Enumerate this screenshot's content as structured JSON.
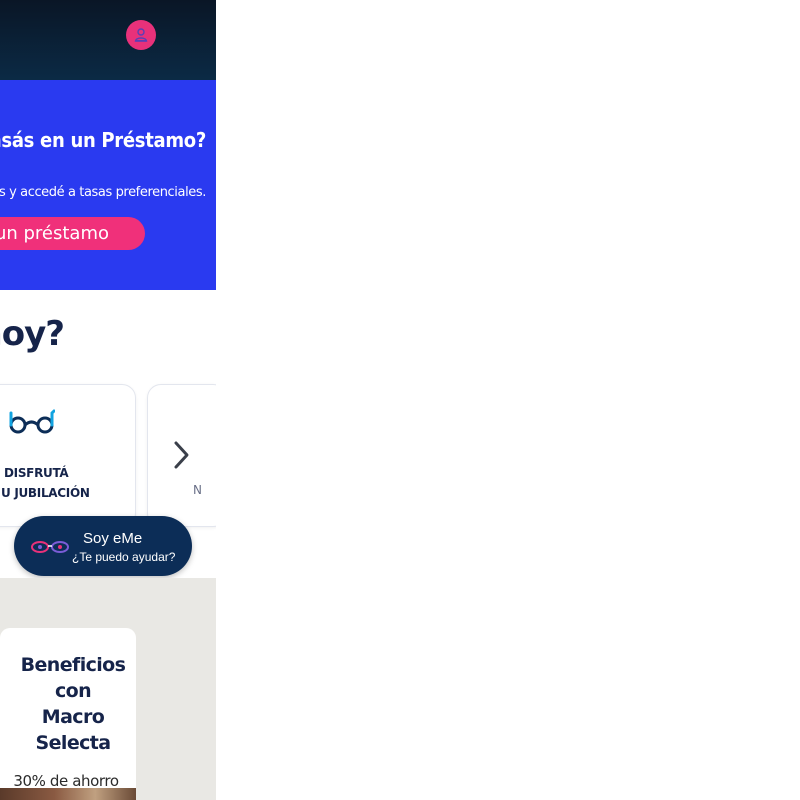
{
  "header": {
    "profile_icon": "person-icon"
  },
  "hero": {
    "title": "ensás en un Préstamo?",
    "subtitle": "ros y accedé a tasas preferenciales.",
    "cta_label": "un préstamo"
  },
  "section": {
    "heading": "hoy?"
  },
  "cards": [
    {
      "icon": "glasses-icon",
      "line1": "DISFRUTÁ",
      "line2": "U JUBILACIÓN"
    },
    {
      "label": "N"
    }
  ],
  "carousel": {
    "next_icon": "chevron-right-icon"
  },
  "chat": {
    "title": "Soy eMe",
    "subtitle": "¿Te puedo ayudar?",
    "icon": "eyes-icon"
  },
  "benefit": {
    "title_lines": [
      "Beneficios",
      "con",
      "Macro",
      "Selecta"
    ],
    "description": "30% de ahorro"
  },
  "colors": {
    "header_bg": "#0b2a45",
    "hero_bg": "#2a3af0",
    "accent_pink": "#f0307a",
    "navy_text": "#16244a",
    "chat_bg": "#0c2d57",
    "band_bg": "#e9e8e4"
  }
}
